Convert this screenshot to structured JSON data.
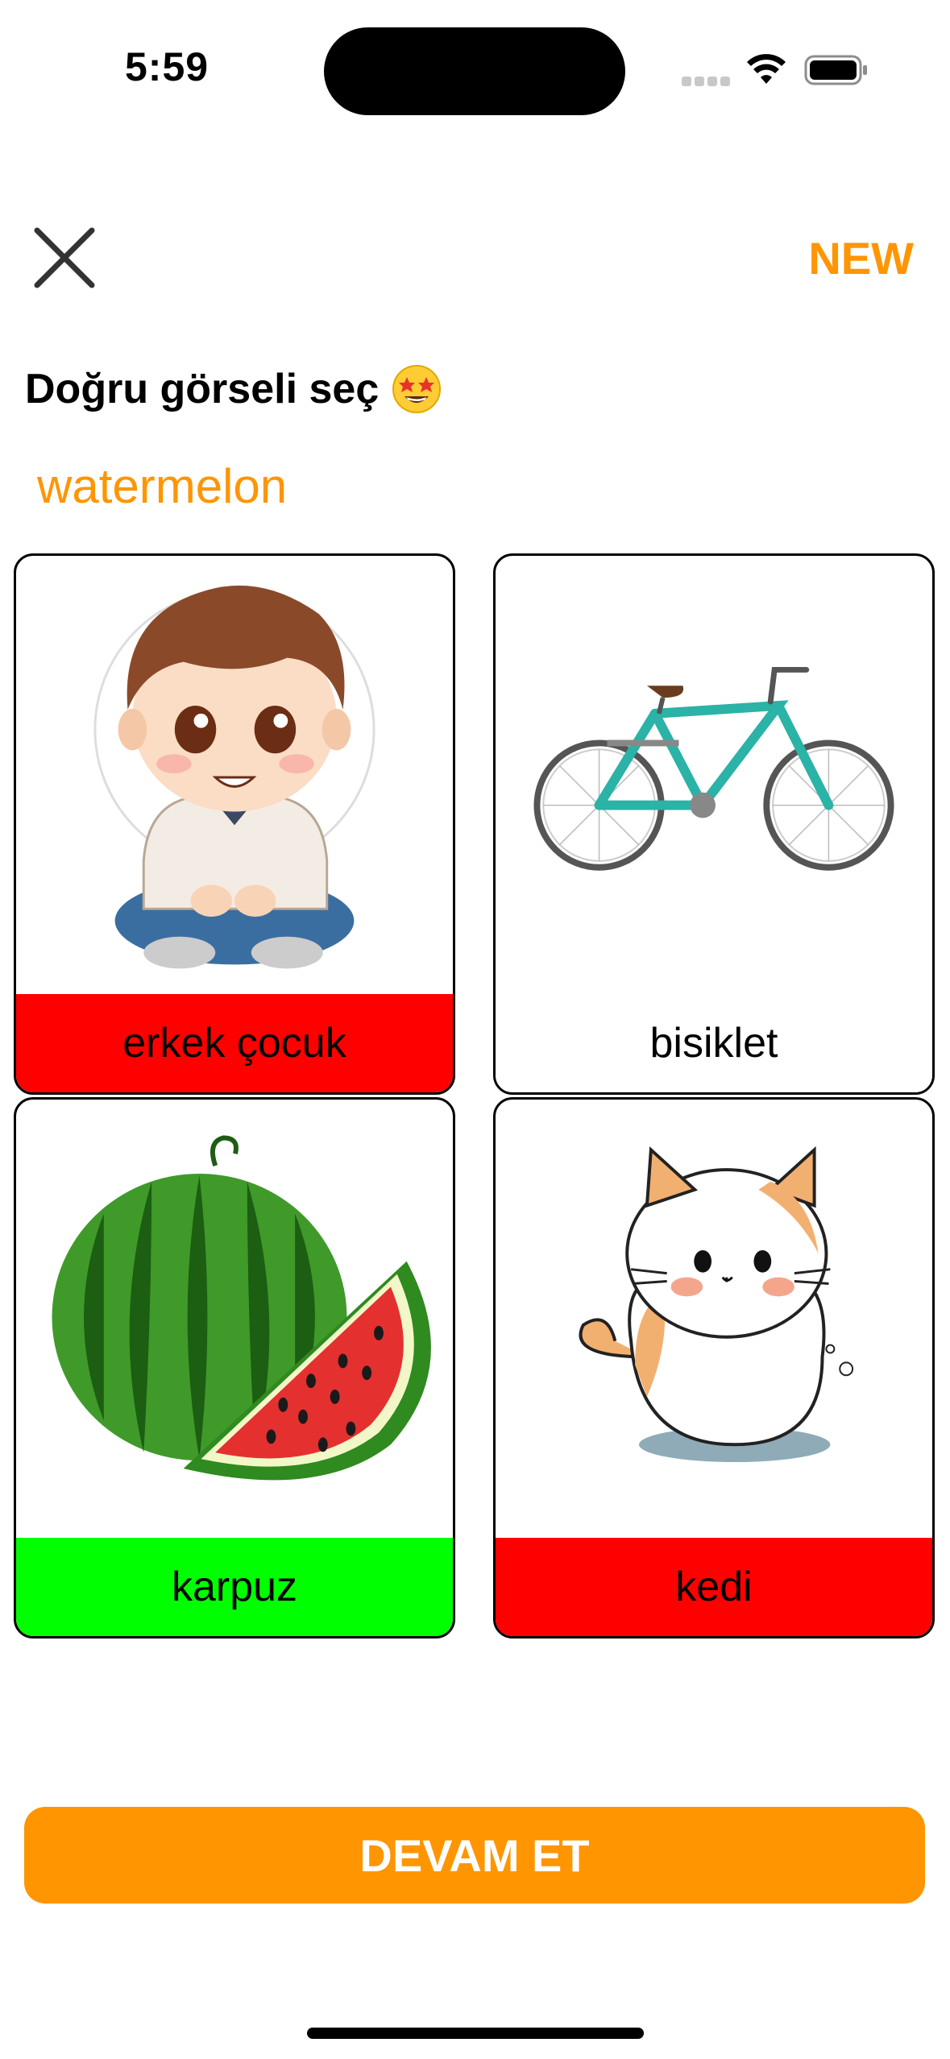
{
  "status_bar": {
    "time": "5:59",
    "icons": [
      "cellular-signal-icon",
      "wifi-icon",
      "battery-icon"
    ]
  },
  "header": {
    "close_icon": "close-icon",
    "new_label": "NEW"
  },
  "prompt": {
    "instruction": "Doğru görseli seç",
    "emoji": "star-struck-emoji",
    "target_word": "watermelon"
  },
  "colors": {
    "accent": "#ff9500",
    "wrong": "#ff0000",
    "correct": "#00ff00"
  },
  "options": [
    {
      "label": "erkek çocuk",
      "image": "boy-illustration",
      "state": "wrong"
    },
    {
      "label": "bisiklet",
      "image": "bicycle-illustration",
      "state": "none"
    },
    {
      "label": "karpuz",
      "image": "watermelon-illustration",
      "state": "correct"
    },
    {
      "label": "kedi",
      "image": "cat-illustration",
      "state": "wrong"
    }
  ],
  "footer": {
    "continue_label": "DEVAM ET"
  }
}
